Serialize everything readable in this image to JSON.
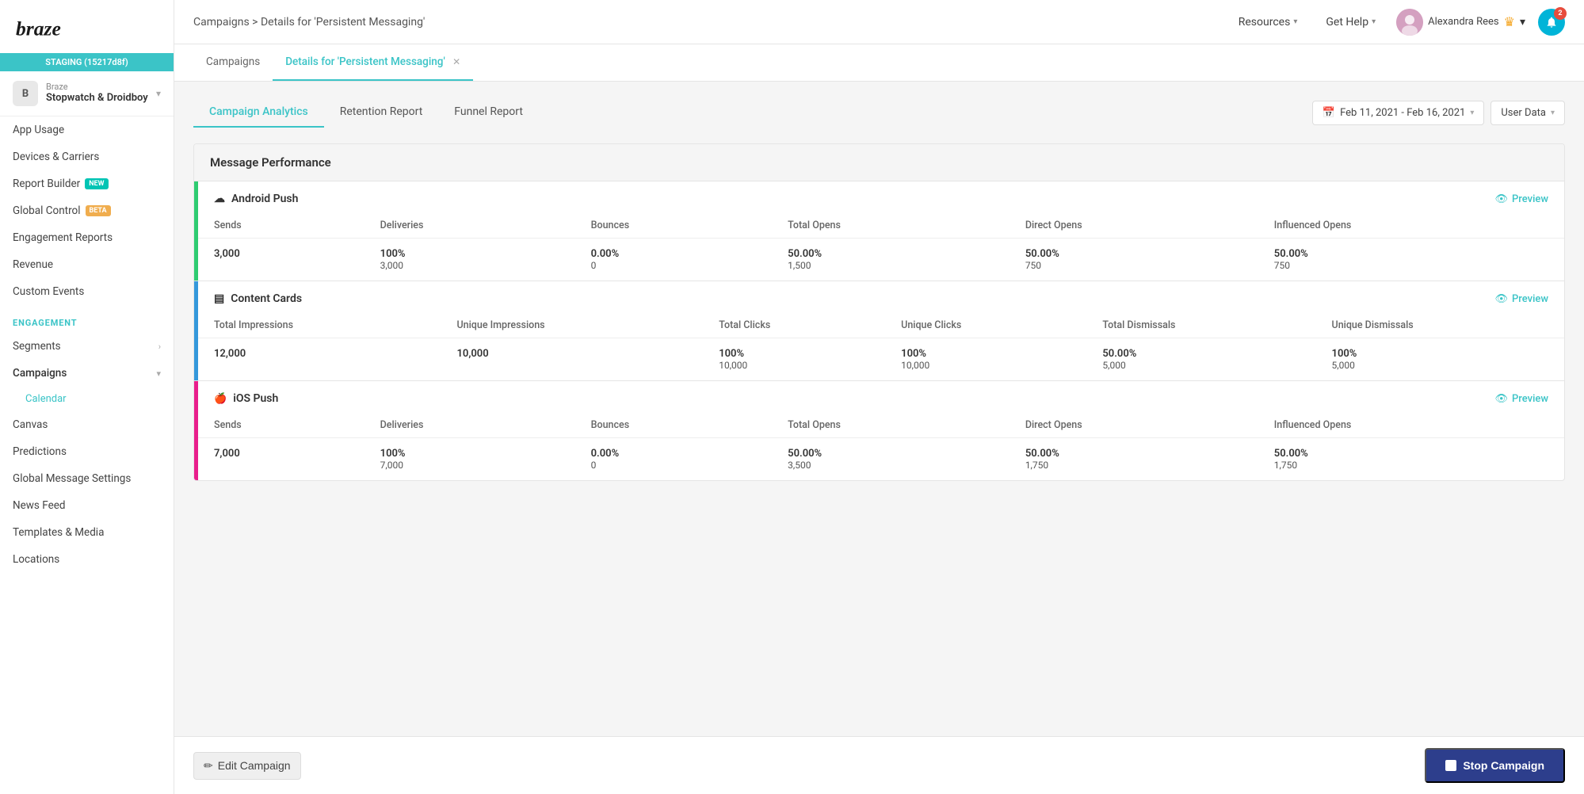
{
  "sidebar": {
    "logo_text": "braze",
    "staging_label": "STAGING (15217d8f)",
    "workspace": {
      "brand": "Braze",
      "name": "Stopwatch & Droidboy",
      "avatar_letter": "B"
    },
    "analytics_items": [
      {
        "label": "App Usage",
        "id": "app-usage"
      },
      {
        "label": "Devices & Carriers",
        "id": "devices-carriers"
      },
      {
        "label": "Report Builder",
        "id": "report-builder",
        "badge": "NEW"
      },
      {
        "label": "Global Control",
        "id": "global-control",
        "badge": "BETA"
      },
      {
        "label": "Engagement Reports",
        "id": "engagement-reports"
      },
      {
        "label": "Revenue",
        "id": "revenue"
      },
      {
        "label": "Custom Events",
        "id": "custom-events"
      }
    ],
    "engagement_label": "ENGAGEMENT",
    "engagement_items": [
      {
        "label": "Segments",
        "id": "segments",
        "has_arrow": true
      },
      {
        "label": "Campaigns",
        "id": "campaigns",
        "has_arrow": true,
        "active": true
      },
      {
        "label": "Canvas",
        "id": "canvas"
      },
      {
        "label": "Predictions",
        "id": "predictions"
      },
      {
        "label": "Global Message Settings",
        "id": "global-message-settings"
      },
      {
        "label": "News Feed",
        "id": "news-feed"
      },
      {
        "label": "Templates & Media",
        "id": "templates-media"
      },
      {
        "label": "Locations",
        "id": "locations"
      }
    ],
    "campaigns_sub": [
      {
        "label": "Calendar",
        "id": "calendar",
        "active": true
      }
    ]
  },
  "topbar": {
    "breadcrumb": "Campaigns > Details for 'Persistent Messaging'",
    "resources_label": "Resources",
    "get_help_label": "Get Help",
    "user_name": "Alexandra Rees",
    "notification_count": "2"
  },
  "tabs": [
    {
      "label": "Campaigns",
      "id": "campaigns-tab",
      "active": false,
      "closable": false
    },
    {
      "label": "Details for 'Persistent Messaging'",
      "id": "details-tab",
      "active": true,
      "closable": true
    }
  ],
  "subtabs": [
    {
      "label": "Campaign Analytics",
      "id": "campaign-analytics",
      "active": true
    },
    {
      "label": "Retention Report",
      "id": "retention-report",
      "active": false
    },
    {
      "label": "Funnel Report",
      "id": "funnel-report",
      "active": false
    }
  ],
  "date_filter": {
    "label": "Feb 11, 2021 - Feb 16, 2021",
    "user_data_label": "User Data"
  },
  "message_performance": {
    "section_title": "Message Performance",
    "channels": [
      {
        "id": "android-push",
        "title": "Android Push",
        "icon": "☁",
        "stripe_color": "green",
        "preview_label": "Preview",
        "columns": [
          "Sends",
          "Deliveries",
          "Bounces",
          "Total Opens",
          "Direct Opens",
          "Influenced Opens"
        ],
        "rows": [
          {
            "sends": "3,000",
            "deliveries_pct": "100%",
            "deliveries_num": "3,000",
            "bounces_pct": "0.00%",
            "bounces_num": "0",
            "total_opens_pct": "50.00%",
            "total_opens_num": "1,500",
            "direct_opens_pct": "50.00%",
            "direct_opens_num": "750",
            "influenced_opens_pct": "50.00%",
            "influenced_opens_num": "750"
          }
        ]
      },
      {
        "id": "content-cards",
        "title": "Content Cards",
        "icon": "▤",
        "stripe_color": "blue",
        "preview_label": "Preview",
        "columns": [
          "Total Impressions",
          "Unique Impressions",
          "Total Clicks",
          "Unique Clicks",
          "Total Dismissals",
          "Unique Dismissals"
        ],
        "rows": [
          {
            "total_impressions": "12,000",
            "unique_impressions": "10,000",
            "total_clicks_pct": "100%",
            "total_clicks_num": "10,000",
            "unique_clicks_pct": "100%",
            "unique_clicks_num": "10,000",
            "total_dismissals_pct": "50.00%",
            "total_dismissals_num": "5,000",
            "unique_dismissals_pct": "100%",
            "unique_dismissals_num": "5,000"
          }
        ]
      },
      {
        "id": "ios-push",
        "title": "iOS Push",
        "icon": "🍎",
        "stripe_color": "pink",
        "preview_label": "Preview",
        "columns": [
          "Sends",
          "Deliveries",
          "Bounces",
          "Total Opens",
          "Direct Opens",
          "Influenced Opens"
        ],
        "rows": [
          {
            "sends": "7,000",
            "deliveries_pct": "100%",
            "deliveries_num": "7,000",
            "bounces_pct": "0.00%",
            "bounces_num": "0",
            "total_opens_pct": "50.00%",
            "total_opens_num": "3,500",
            "direct_opens_pct": "50.00%",
            "direct_opens_num": "1,750",
            "influenced_opens_pct": "50.00%",
            "influenced_opens_num": "1,750"
          }
        ]
      }
    ]
  },
  "bottombar": {
    "edit_label": "Edit Campaign",
    "stop_label": "Stop Campaign"
  }
}
